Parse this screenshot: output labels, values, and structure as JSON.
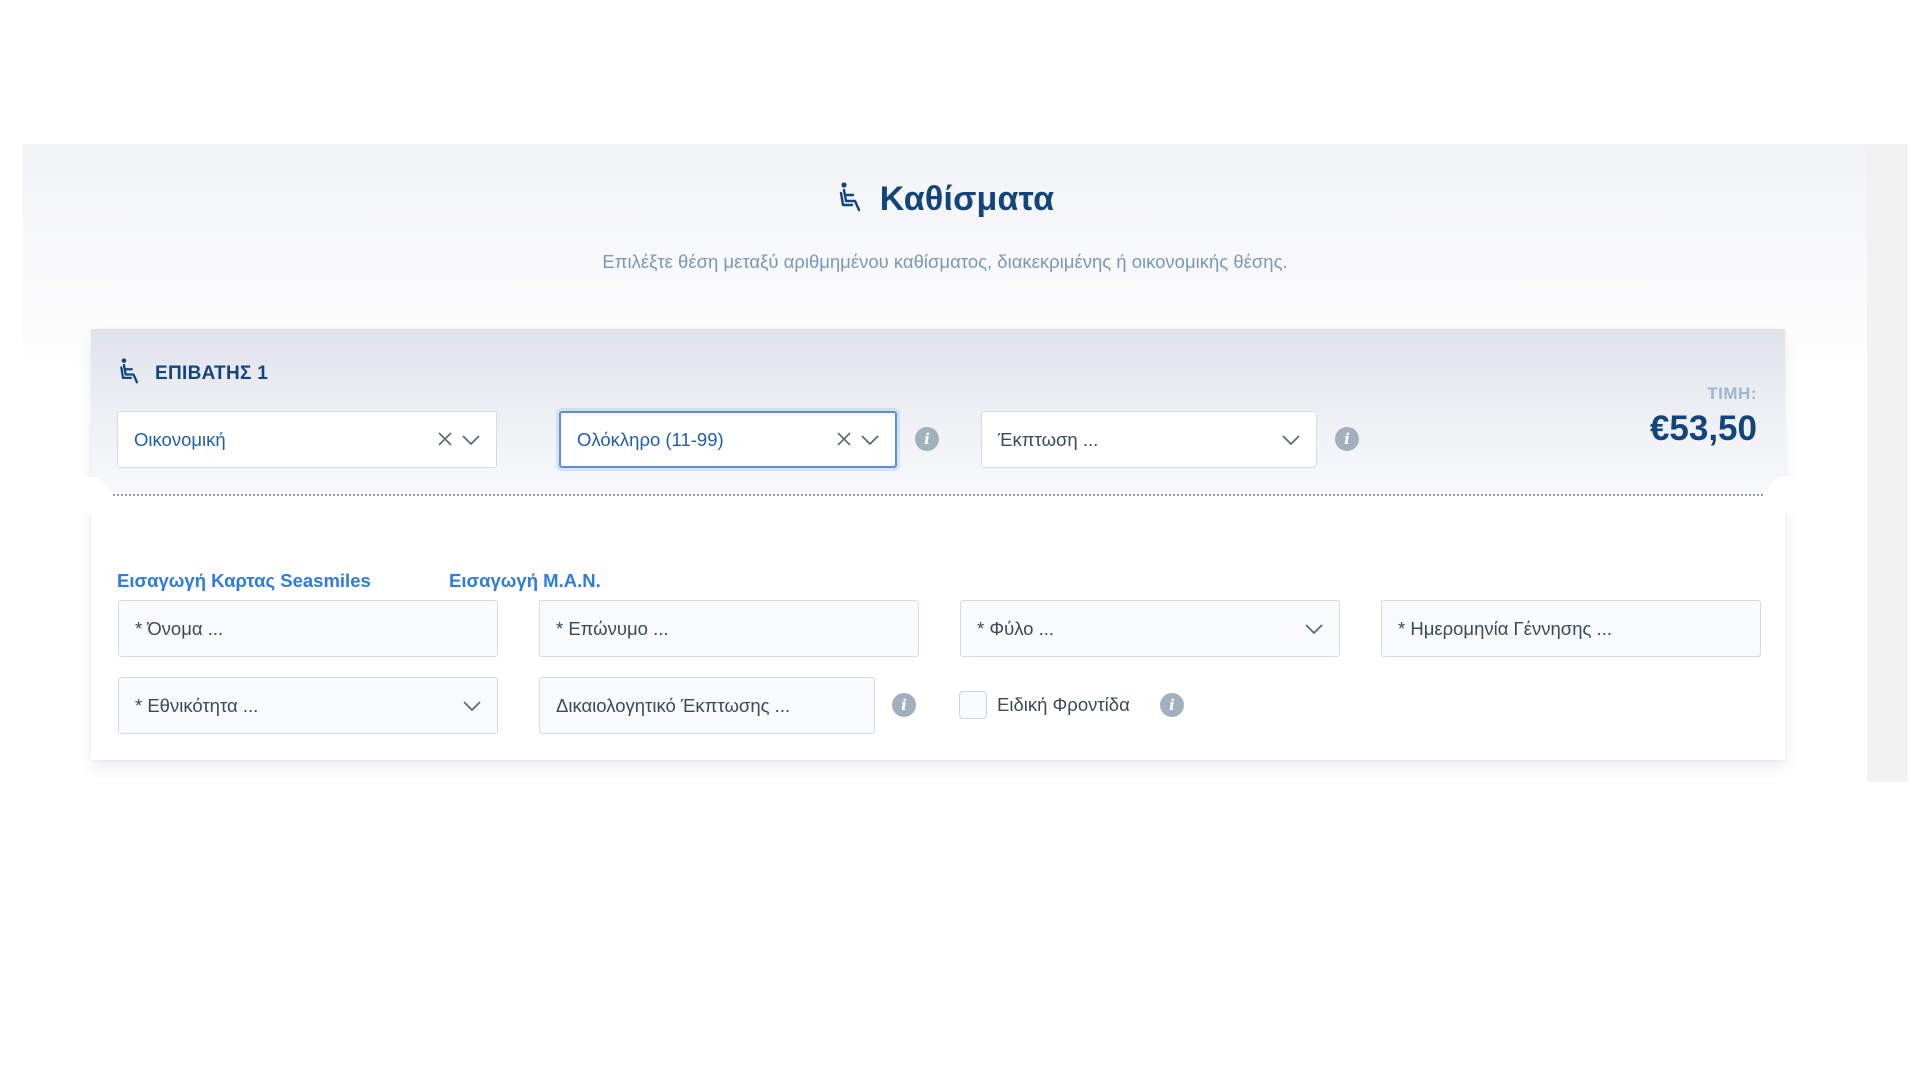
{
  "section": {
    "title": "Καθίσματα",
    "subtitle": "Επιλέξτε θέση μεταξύ αριθμημένου καθίσματος, διακεκριμένης ή οικονομικής θέσης.",
    "icon": "seat-icon"
  },
  "passenger": {
    "label": "ΕΠΙΒΑΤΗΣ 1",
    "icon": "seat-icon",
    "price_label": "ΤΙΜΗ:",
    "price_value": "€53,50",
    "seat_class": {
      "value": "Οικονομική"
    },
    "fare_type": {
      "value": "Ολόκληρο (11-99)"
    },
    "discount": {
      "placeholder": "Έκπτωση ..."
    }
  },
  "links": {
    "seasmiles": "Εισαγωγή Καρτας Seasmiles",
    "man": "Εισαγωγή Μ.Α.Ν."
  },
  "form": {
    "first_name": "* Όνομα ...",
    "last_name": "* Επώνυμο ...",
    "gender": "* Φύλο ...",
    "birth_date": "* Ημερομηνία Γέννησης ...",
    "nationality": "* Εθνικότητα ...",
    "discount_doc": "Δικαιολογητικό Έκπτωσης ...",
    "special_care": "Ειδική Φροντίδα",
    "special_care_checked": false
  },
  "colors": {
    "primary": "#13457c",
    "link": "#2f7be0",
    "subtitle": "#7a98b5",
    "info_icon": "#a2afbd",
    "focus_border": "#5b8fd8"
  }
}
